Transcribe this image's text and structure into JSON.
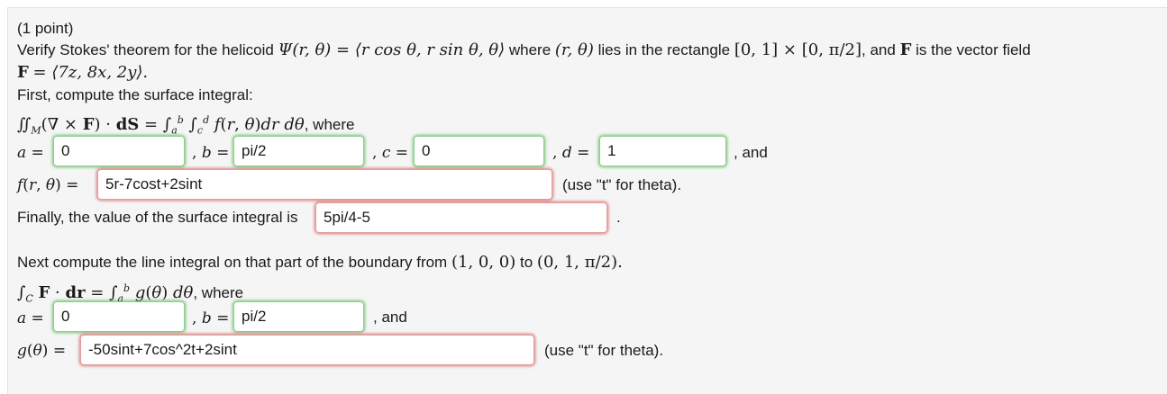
{
  "problem": {
    "points": "(1 point)",
    "statement_1": "Verify Stokes' theorem for the helicoid",
    "helicoid_expr": "Ψ(r, θ) = ⟨r cos θ, r sin θ, θ⟩",
    "statement_2": "where",
    "rect_vars": "(r, θ)",
    "statement_3": "lies in the rectangle",
    "rectangle": "[0, 1] × [0, π/2]",
    "statement_4": ", and",
    "F_symbol": "F",
    "statement_5": "is the vector field",
    "field_def_F": "F",
    "field_def_rest": "= ⟨7z, 8x, 2y⟩.",
    "step1": "First, compute the surface integral:",
    "step2_where": ", where",
    "step3": "Finally, the value of the surface integral is",
    "step4_prefix": "Next compute the line integral on that part of the boundary from",
    "from_point": "(1, 0, 0)",
    "to_word": "to",
    "to_point": "(0, 1, π/2).",
    "line_where": ", where",
    "and_word": ", and",
    "theta_hint": "(use \"t\" for theta)."
  },
  "surface": {
    "a_value": "0",
    "b_value": "pi/2",
    "c_value": "0",
    "d_value": "1",
    "f_value": "5r-7cost+2sint",
    "result_value": "5pi/4-5"
  },
  "line": {
    "a_value": "0",
    "b_value": "pi/2",
    "g_value": "-50sint+7cos^2t+2sint"
  },
  "colors": {
    "correct_glow": "#4cb44c",
    "wrong_glow": "#d65050",
    "panel_bg": "#f5f5f5"
  }
}
